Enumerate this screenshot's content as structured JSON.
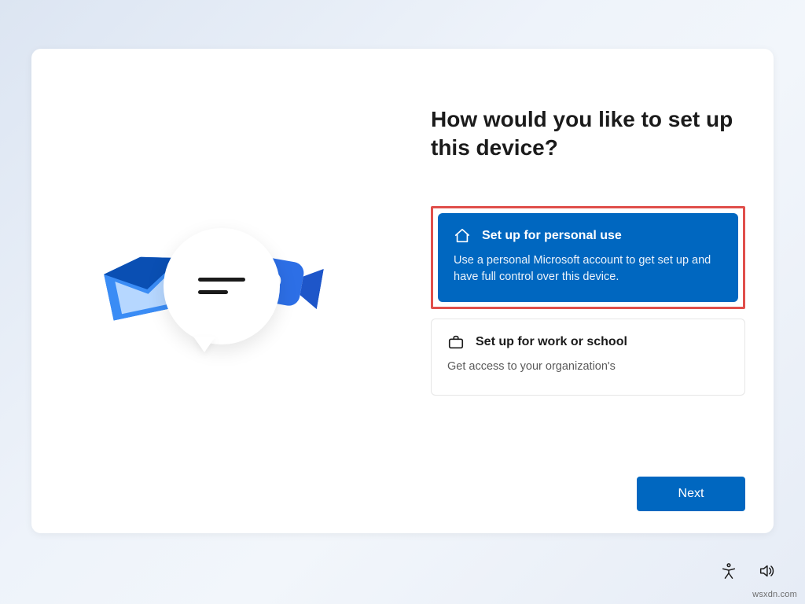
{
  "heading": "How would you like to set up this device?",
  "options": [
    {
      "icon": "home-icon",
      "title": "Set up for personal use",
      "desc": "Use a personal Microsoft account to get set up and have full control over this device.",
      "selected": true
    },
    {
      "icon": "briefcase-icon",
      "title": "Set up for work or school",
      "desc": "Get access to your organization's",
      "selected": false
    }
  ],
  "next_label": "Next",
  "tray": {
    "accessibility": "accessibility-icon",
    "volume": "volume-icon"
  },
  "watermark": "wsxdn.com",
  "colors": {
    "accent": "#0067c0",
    "highlight": "#e04f4b"
  }
}
